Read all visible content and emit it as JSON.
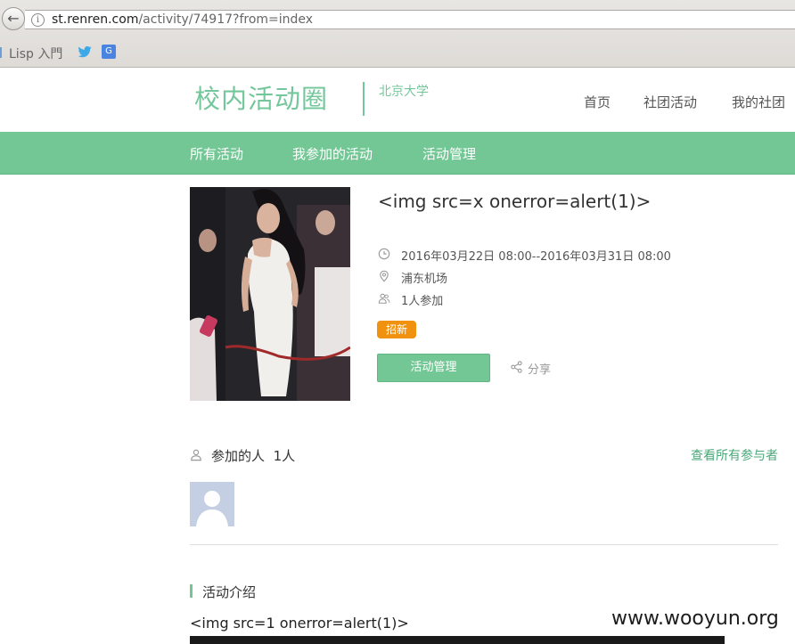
{
  "browser": {
    "url_domain": "st.renren.com",
    "url_path": "/activity/74917?from=index",
    "bookmarks": [
      {
        "label": "Lisp 入門",
        "icon": "lisp-icon"
      },
      {
        "label": "",
        "icon": "twitter-icon"
      },
      {
        "label": "",
        "icon": "google-translate-icon"
      }
    ]
  },
  "header": {
    "logo": "校内活动圈",
    "school": "北京大学",
    "nav": {
      "home": "首页",
      "club_activity": "社团活动",
      "my_club": "我的社团"
    }
  },
  "tabs": {
    "all": "所有活动",
    "joined": "我参加的活动",
    "manage": "活动管理"
  },
  "activity": {
    "title": "<img src=x onerror=alert(1)>",
    "time": "2016年03月22日 08:00--2016年03月31日 08:00",
    "location": "浦东机场",
    "participants": "1人参加",
    "badge": "招新",
    "manage_button": "活动管理",
    "share": "分享"
  },
  "participants": {
    "title": "参加的人",
    "count": "1人",
    "view_all": "查看所有参与者"
  },
  "intro": {
    "heading": "活动介绍",
    "text": "<img src=1 onerror=alert(1)>"
  },
  "watermark": "www.wooyun.org",
  "colors": {
    "accent": "#73c795",
    "badge": "#f0920f",
    "link": "#4aa779"
  }
}
